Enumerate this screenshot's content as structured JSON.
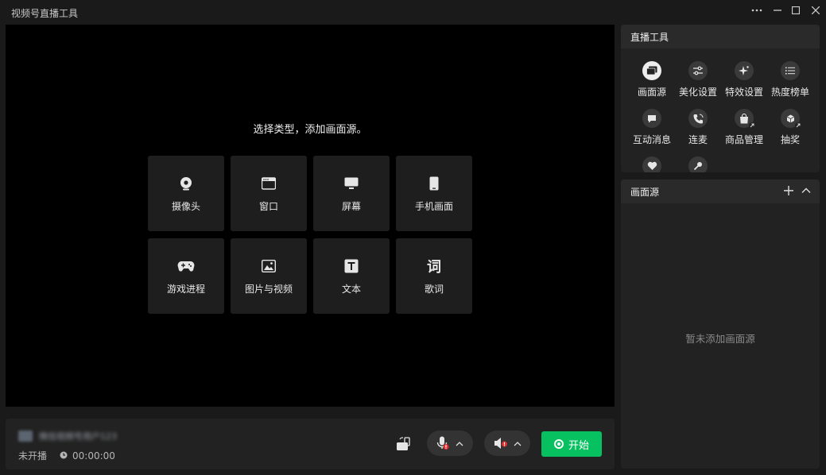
{
  "app": {
    "title": "视频号直播工具"
  },
  "preview": {
    "hint": "选择类型，添加画面源。",
    "sources": [
      {
        "label": "摄像头",
        "icon": "camera-icon"
      },
      {
        "label": "窗口",
        "icon": "window-icon"
      },
      {
        "label": "屏幕",
        "icon": "monitor-icon"
      },
      {
        "label": "手机画面",
        "icon": "phone-icon"
      },
      {
        "label": "游戏进程",
        "icon": "gamepad-icon"
      },
      {
        "label": "图片与视频",
        "icon": "image-icon"
      },
      {
        "label": "文本",
        "icon": "text-icon"
      },
      {
        "label": "歌词",
        "icon": "lyrics-icon",
        "glyph": "词"
      }
    ]
  },
  "bottom": {
    "account_name": "微信视频号用户123",
    "status": "未开播",
    "timer": "00:00:00",
    "start_label": "开始"
  },
  "tools_panel": {
    "title": "直播工具",
    "items": [
      {
        "label": "画面源",
        "icon": "scene-source-icon"
      },
      {
        "label": "美化设置",
        "icon": "sliders-icon"
      },
      {
        "label": "特效设置",
        "icon": "sparkle-icon"
      },
      {
        "label": "热度榜单",
        "icon": "list-icon"
      },
      {
        "label": "互动消息",
        "icon": "chat-icon"
      },
      {
        "label": "连麦",
        "icon": "phone-call-icon"
      },
      {
        "label": "商品管理",
        "icon": "shopping-bag-icon"
      },
      {
        "label": "抽奖",
        "icon": "gift-icon"
      },
      {
        "label": "",
        "icon": "heart-icon"
      },
      {
        "label": "",
        "icon": "microphone-icon"
      }
    ]
  },
  "sources_panel": {
    "title": "画面源",
    "empty_text": "暂未添加画面源"
  },
  "colors": {
    "accent": "#07c160",
    "background": "#1a1a1a",
    "panel": "#222222"
  }
}
